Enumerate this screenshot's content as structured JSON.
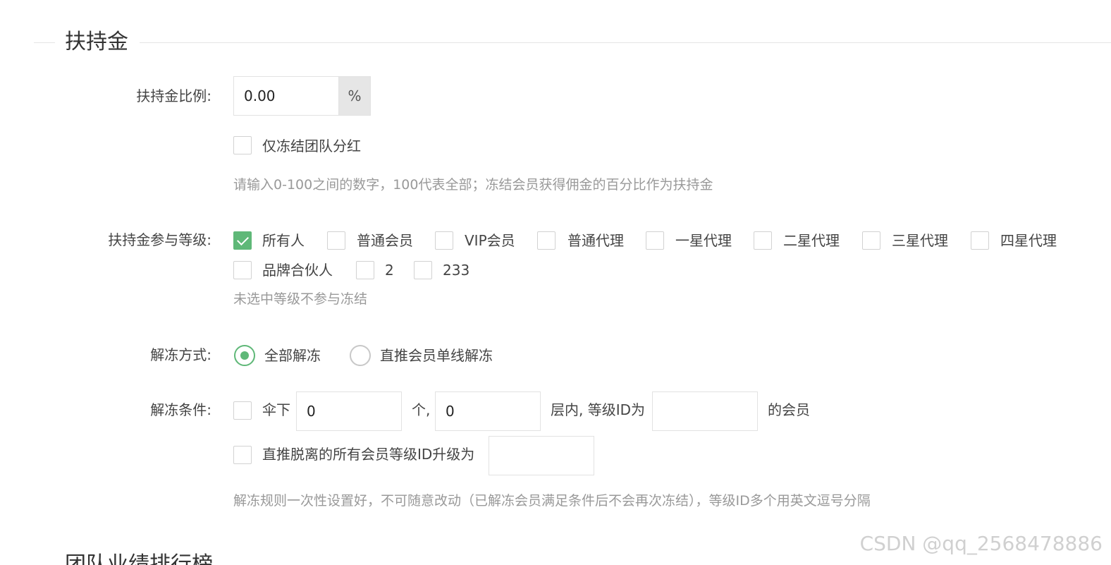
{
  "section": {
    "title": "扶持金"
  },
  "ratio": {
    "label": "扶持金比例:",
    "value": "0.00",
    "unit": "%",
    "freeze_team_only_label": "仅冻结团队分红",
    "hint": "请输入0-100之间的数字，100代表全部；冻结会员获得佣金的百分比作为扶持金"
  },
  "levels": {
    "label": "扶持金参与等级:",
    "options": [
      {
        "label": "所有人",
        "checked": true
      },
      {
        "label": "普通会员",
        "checked": false
      },
      {
        "label": "VIP会员",
        "checked": false
      },
      {
        "label": "普通代理",
        "checked": false
      },
      {
        "label": "一星代理",
        "checked": false
      },
      {
        "label": "二星代理",
        "checked": false
      },
      {
        "label": "三星代理",
        "checked": false
      },
      {
        "label": "四星代理",
        "checked": false
      },
      {
        "label": "品牌合伙人",
        "checked": false
      },
      {
        "label": "2",
        "checked": false
      },
      {
        "label": "233",
        "checked": false
      }
    ],
    "hint": "未选中等级不参与冻结"
  },
  "unfreeze_mode": {
    "label": "解冻方式:",
    "options": [
      {
        "label": "全部解冻",
        "selected": true
      },
      {
        "label": "直推会员单线解冻",
        "selected": false
      }
    ]
  },
  "unfreeze_condition": {
    "label": "解冻条件:",
    "row1": {
      "prefix": "伞下",
      "count_value": "0",
      "mid": "个,",
      "layer_value": "0",
      "suffix": "层内, 等级ID为",
      "level_id_value": "",
      "end": "的会员"
    },
    "row2": {
      "text": "直推脱离的所有会员等级ID升级为",
      "value": ""
    },
    "hint": "解冻规则一次性设置好，不可随意改动（已解冻会员满足条件后不会再次冻结），等级ID多个用英文逗号分隔"
  },
  "next_section": {
    "title": "团队业绩排行榜"
  },
  "watermark": "CSDN @qq_2568478886",
  "colors": {
    "accent": "#5fb878",
    "hint": "#999999",
    "border": "#e2e2e2"
  }
}
